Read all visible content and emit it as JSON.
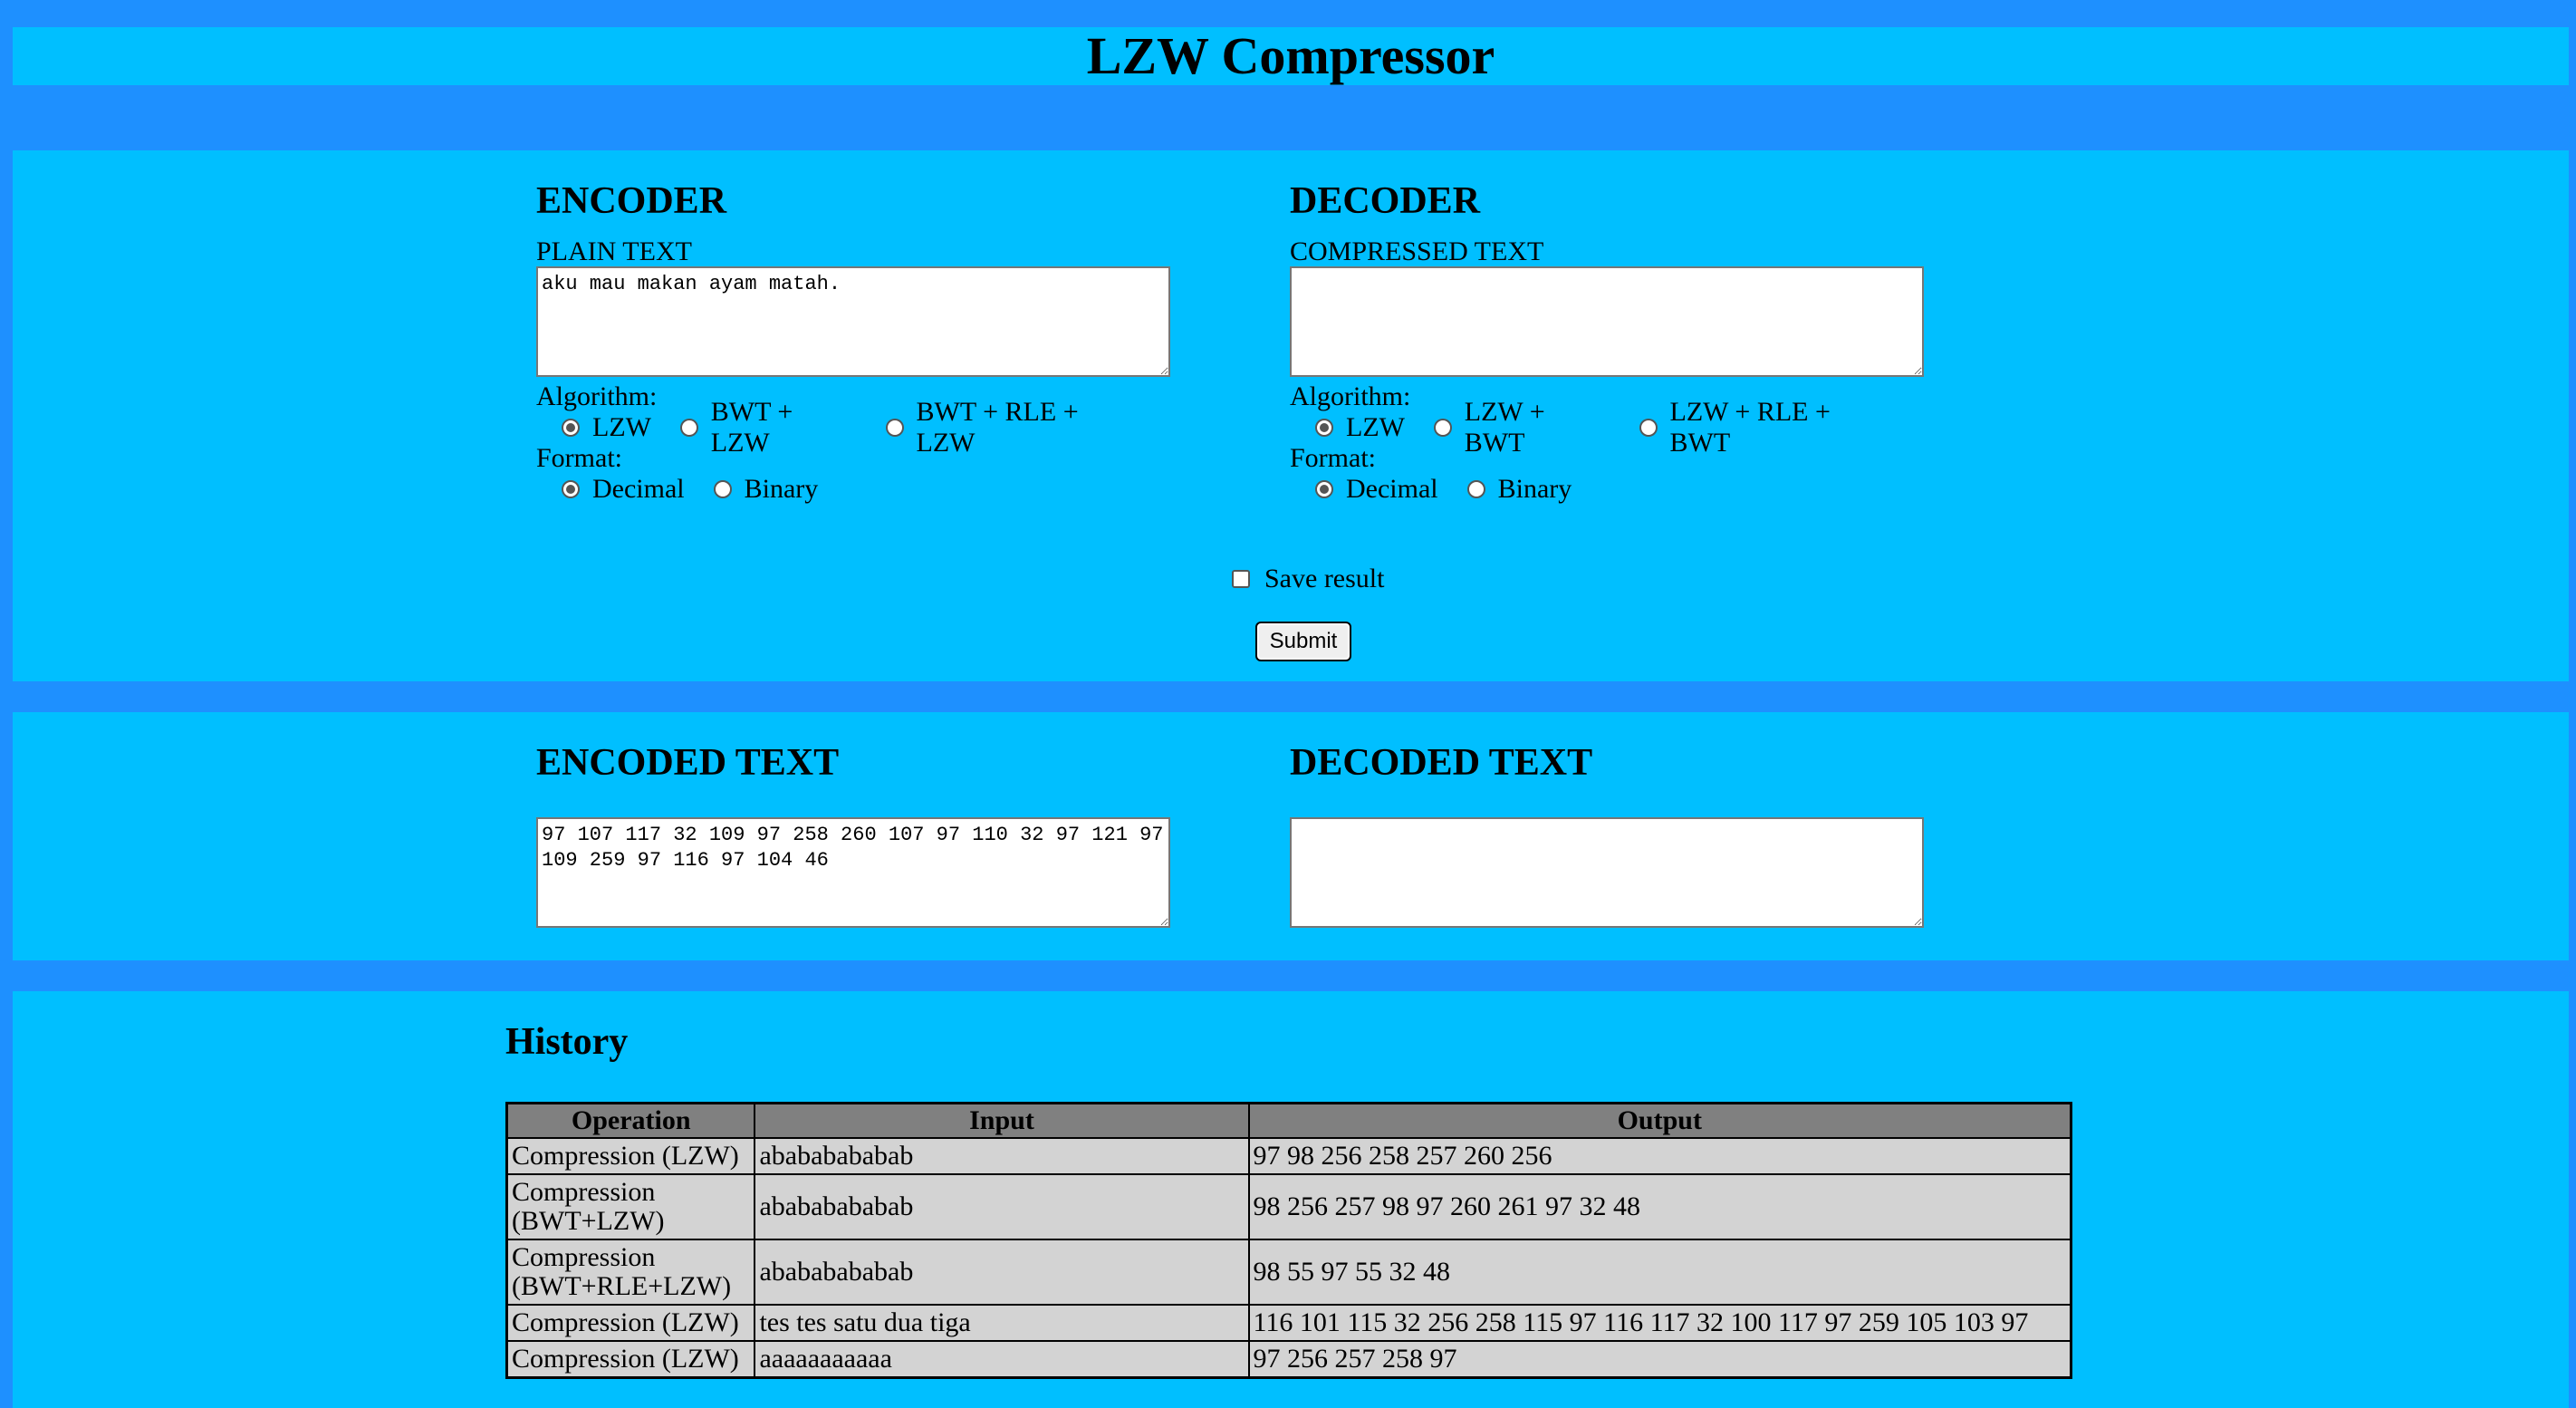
{
  "app": {
    "title": "LZW Compressor"
  },
  "encoder": {
    "heading": "ENCODER",
    "input_label": "PLAIN TEXT",
    "input_value": "aku mau makan ayam matah.",
    "algorithm_label": "Algorithm:",
    "algorithms": [
      {
        "label": "LZW",
        "checked": true
      },
      {
        "label": "BWT + LZW",
        "checked": false
      },
      {
        "label": "BWT + RLE + LZW",
        "checked": false
      }
    ],
    "format_label": "Format:",
    "formats": [
      {
        "label": "Decimal",
        "checked": true
      },
      {
        "label": "Binary",
        "checked": false
      }
    ]
  },
  "decoder": {
    "heading": "DECODER",
    "input_label": "COMPRESSED TEXT",
    "input_value": "",
    "algorithm_label": "Algorithm:",
    "algorithms": [
      {
        "label": "LZW",
        "checked": true
      },
      {
        "label": "LZW + BWT",
        "checked": false
      },
      {
        "label": "LZW + RLE + BWT",
        "checked": false
      }
    ],
    "format_label": "Format:",
    "formats": [
      {
        "label": "Decimal",
        "checked": true
      },
      {
        "label": "Binary",
        "checked": false
      }
    ]
  },
  "options": {
    "save_result_label": "Save result",
    "save_result_checked": false,
    "submit_label": "Submit"
  },
  "results": {
    "encoded_heading": "ENCODED TEXT",
    "encoded_value": "97 107 117 32 109 97 258 260 107 97 110 32 97 121 97 109 259 97 116 97 104 46",
    "decoded_heading": "DECODED TEXT",
    "decoded_value": ""
  },
  "history": {
    "heading": "History",
    "columns": [
      "Operation",
      "Input",
      "Output"
    ],
    "rows": [
      {
        "operation": "Compression (LZW)",
        "input": "abababababab",
        "output": "97 98 256 258 257 260 256"
      },
      {
        "operation": "Compression (BWT+LZW)",
        "input": "abababababab",
        "output": "98 256 257 98 97 260 261 97 32 48"
      },
      {
        "operation": "Compression (BWT+RLE+LZW)",
        "input": "abababababab",
        "output": "98 55 97 55 32 48"
      },
      {
        "operation": "Compression (LZW)",
        "input": "tes tes satu dua tiga",
        "output": "116 101 115 32 256 258 115 97 116 117 32 100 117 97 259 105 103 97"
      },
      {
        "operation": "Compression (LZW)",
        "input": "aaaaaaaaaaa",
        "output": "97 256 257 258 97"
      }
    ]
  }
}
